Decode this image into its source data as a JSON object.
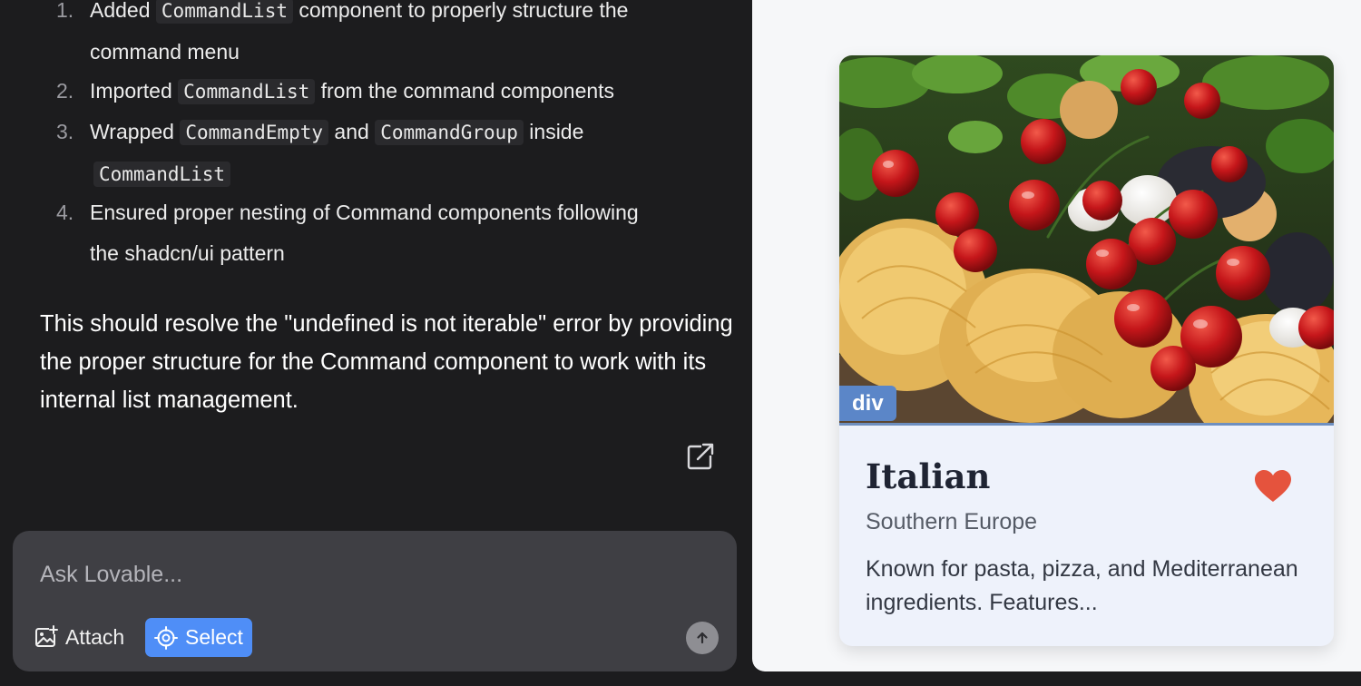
{
  "chat": {
    "steps": [
      {
        "number": "1.",
        "text_before": "Added ",
        "code1": "CommandList",
        "text_after": " component to properly structure the",
        "line2": "command menu"
      },
      {
        "number": "2.",
        "text_before": "Imported ",
        "code1": "CommandList",
        "text_after": " from the command components"
      },
      {
        "number": "3.",
        "text_before": "Wrapped ",
        "code1": "CommandEmpty",
        "text_middle": " and ",
        "code2": "CommandGroup",
        "text_after": " inside",
        "code3": "CommandList"
      },
      {
        "number": "4.",
        "line1": "Ensured proper nesting of Command components following",
        "line2": "the shadcn/ui pattern"
      }
    ],
    "summary": "This should resolve the \"undefined is not iterable\" error by providing the proper structure for the Command component to work with its internal list management.",
    "open_icon": "external-link-icon"
  },
  "composer": {
    "placeholder": "Ask Lovable...",
    "attach_label": "Attach",
    "select_label": "Select",
    "attach_icon": "image-plus-icon",
    "select_icon": "crosshair-icon",
    "send_icon": "arrow-up-icon"
  },
  "preview": {
    "element_tag": "div",
    "card": {
      "title": "Italian",
      "region": "Southern Europe",
      "description": "Known for pasta, pizza, and Mediterranean ingredients. Features...",
      "favorite_icon": "heart-icon",
      "favorite_color": "#e5533d"
    }
  },
  "colors": {
    "chat_bg": "#1c1c1e",
    "composer_bg": "#3f3f44",
    "select_accent": "#4f8ef7",
    "tag_accent": "#5b86c8"
  }
}
